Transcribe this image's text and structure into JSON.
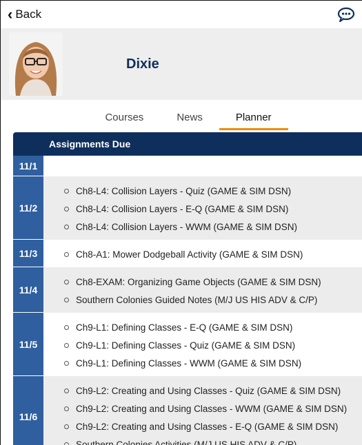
{
  "topbar": {
    "back_label": "Back",
    "chat_icon": "chat-bubble-icon"
  },
  "profile": {
    "name": "Dixie",
    "avatar": "student-avatar"
  },
  "tabs": [
    {
      "label": "Courses",
      "active": false
    },
    {
      "label": "News",
      "active": false
    },
    {
      "label": "Planner",
      "active": true
    }
  ],
  "planner": {
    "header": "Assignments Due",
    "days": [
      {
        "date": "11/1",
        "items": []
      },
      {
        "date": "11/2",
        "items": [
          "Ch8-L4: Collision Layers - Quiz (GAME & SIM DSN)",
          "Ch8-L4: Collision Layers - E-Q (GAME & SIM DSN)",
          "Ch8-L4: Collision Layers - WWM (GAME & SIM DSN)"
        ]
      },
      {
        "date": "11/3",
        "items": [
          "Ch8-A1: Mower Dodgeball Activity (GAME & SIM DSN)"
        ]
      },
      {
        "date": "11/4",
        "items": [
          "Ch8-EXAM: Organizing Game Objects (GAME & SIM DSN)",
          "Southern Colonies Guided Notes (M/J US HIS ADV & C/P)"
        ]
      },
      {
        "date": "11/5",
        "items": [
          "Ch9-L1: Defining Classes - E-Q (GAME & SIM DSN)",
          "Ch9-L1: Defining Classes - Quiz (GAME & SIM DSN)",
          "Ch9-L1: Defining Classes - WWM (GAME & SIM DSN)"
        ]
      },
      {
        "date": "11/6",
        "items": [
          "Ch9-L2: Creating and Using Classes - Quiz (GAME & SIM DSN)",
          "Ch9-L2: Creating and Using Classes - WWM (GAME & SIM DSN)",
          "Ch9-L2: Creating and Using Classes - E-Q (GAME & SIM DSN)",
          "Southern Colonies Activities (M/J US HIS ADV & C/P)"
        ]
      }
    ]
  }
}
